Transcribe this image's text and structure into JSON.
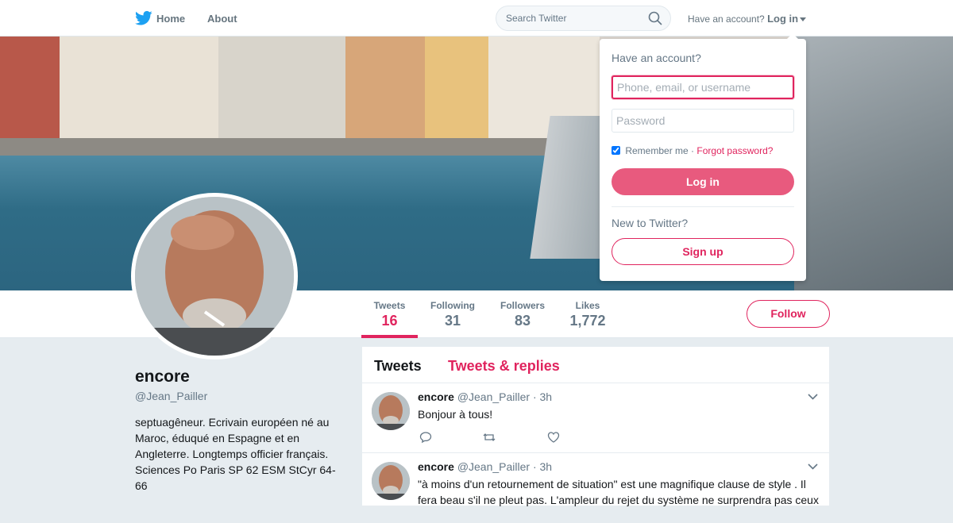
{
  "nav": {
    "logo_icon": "twitter-bird-icon",
    "home_label": "Home",
    "about_label": "About",
    "search_placeholder": "Search Twitter",
    "have_account_label": "Have an account?",
    "login_label": "Log in"
  },
  "profile": {
    "name": "encore",
    "handle": "@Jean_Pailler",
    "bio": "septuagêneur. Ecrivain européen né au Maroc, éduqué en Espagne et en Angleterre. Longtemps officier français. Sciences Po Paris SP 62 ESM StCyr 64-66",
    "follow_label": "Follow"
  },
  "stats": [
    {
      "label": "Tweets",
      "value": "16",
      "active": true
    },
    {
      "label": "Following",
      "value": "31",
      "active": false
    },
    {
      "label": "Followers",
      "value": "83",
      "active": false
    },
    {
      "label": "Likes",
      "value": "1,772",
      "active": false
    }
  ],
  "timeline": {
    "tab_tweets": "Tweets",
    "tab_replies": "Tweets & replies",
    "tweets": [
      {
        "name": "encore",
        "handle": "@Jean_Pailler",
        "time": "· 3h",
        "text": "Bonjour à tous!"
      },
      {
        "name": "encore",
        "handle": "@Jean_Pailler",
        "time": "· 3h",
        "text": "\"à moins d'un retournement de situation\" est une magnifique clause de style . Il fera beau s'il ne pleut pas. L'ampleur du rejet du système ne surprendra pas ceux"
      }
    ]
  },
  "login_dropdown": {
    "title": "Have an account?",
    "username_placeholder": "Phone, email, or username",
    "password_placeholder": "Password",
    "remember_label": "Remember me",
    "separator": "·",
    "forgot_label": "Forgot password?",
    "login_button": "Log in",
    "new_label": "New to Twitter?",
    "signup_button": "Sign up"
  },
  "colors": {
    "accent": "#e0245e",
    "brand": "#1da1f2",
    "muted": "#657786"
  }
}
